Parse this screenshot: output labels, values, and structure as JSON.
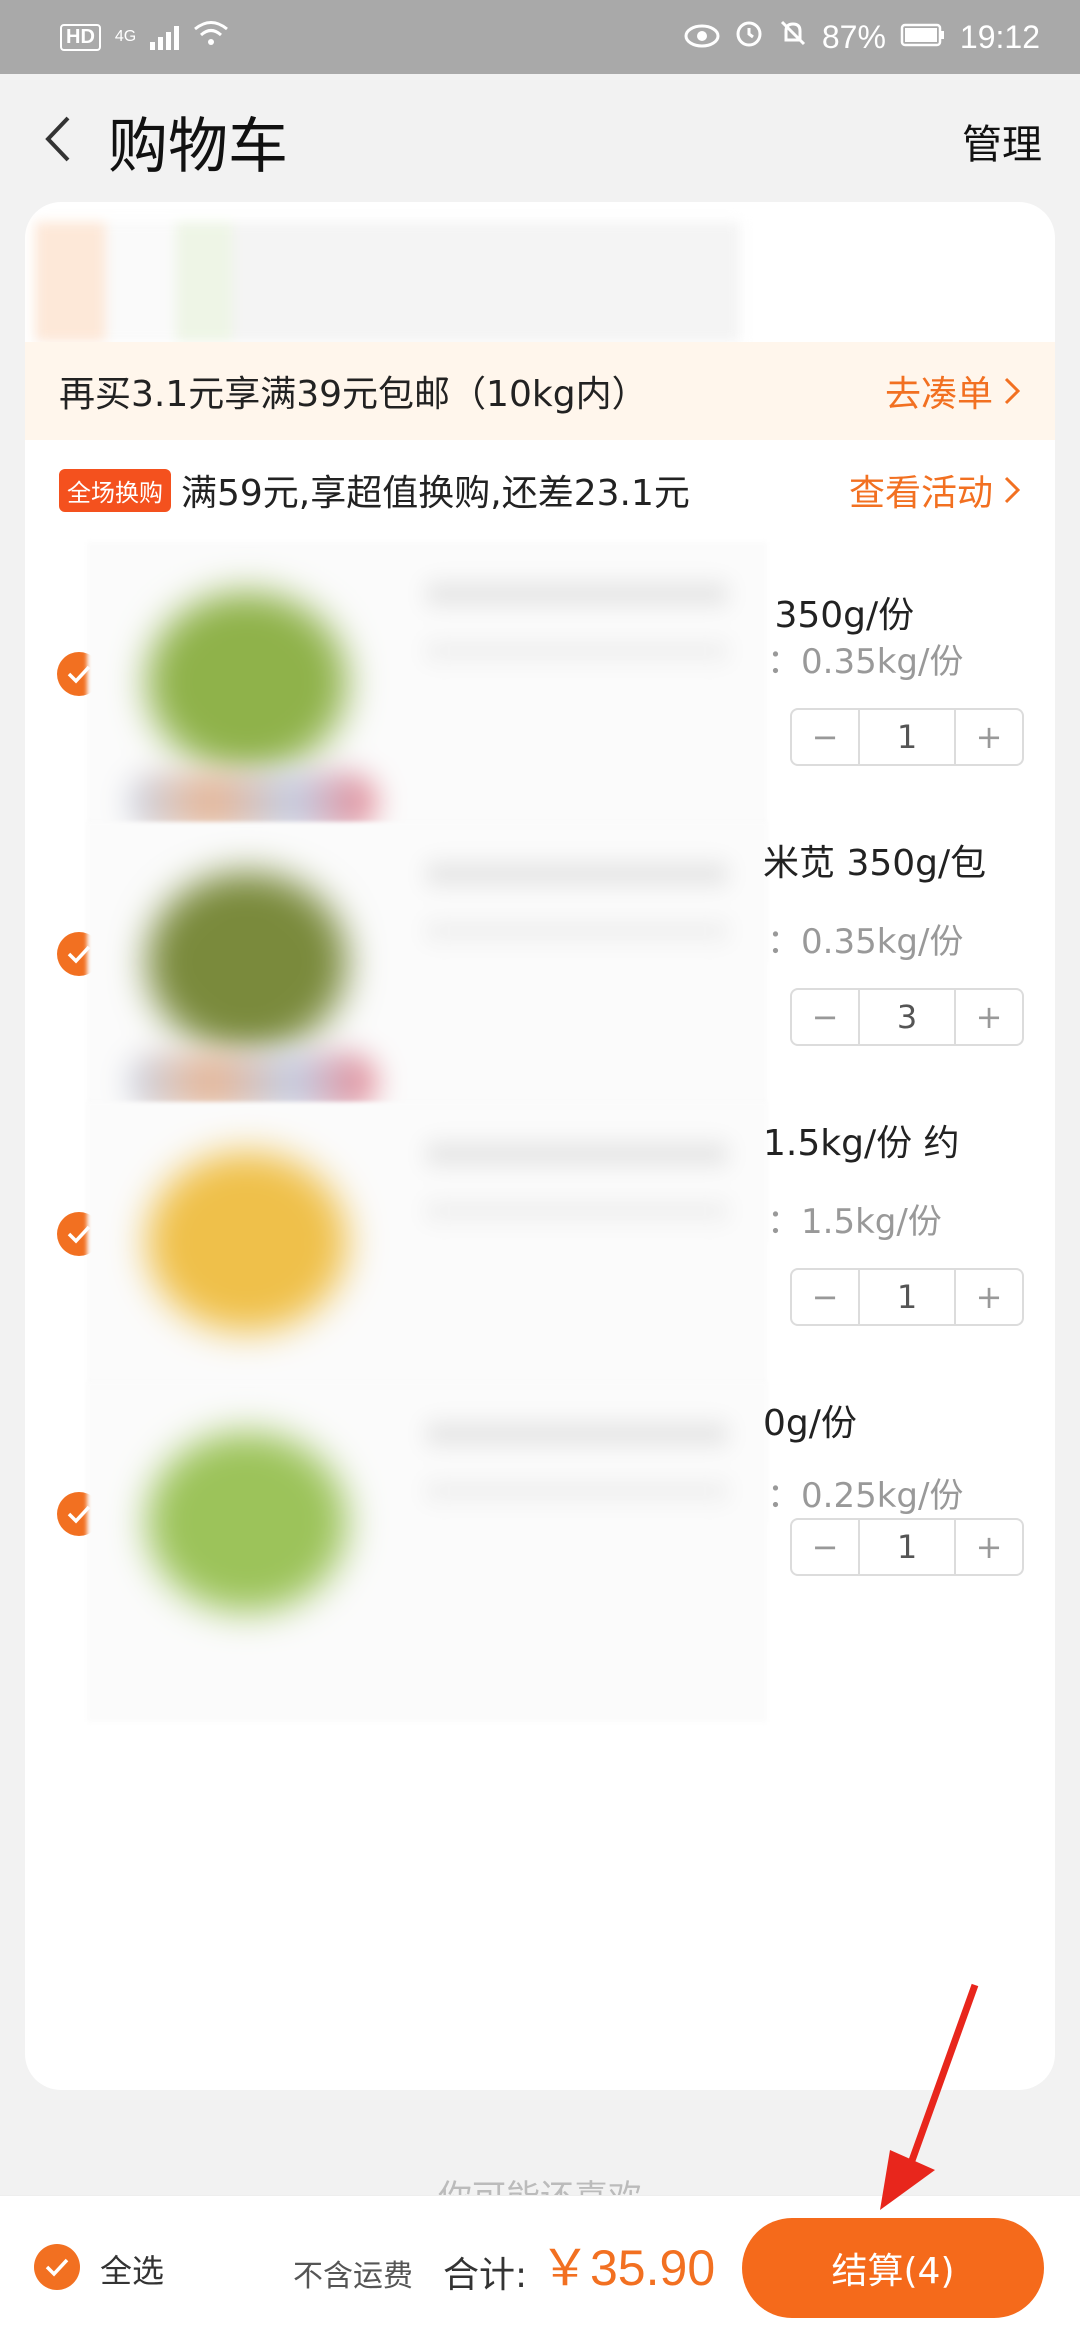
{
  "status_bar": {
    "hd": "HD",
    "network": "4G",
    "battery": "87%",
    "time": "19:12"
  },
  "header": {
    "title": "购物车",
    "manage_label": "管理"
  },
  "shipping": {
    "text": "再买3.1元享满39元包邮（10kg内）",
    "link_label": "去凑单"
  },
  "promo": {
    "tag": "全场换购",
    "text": "满59元,享超值换购,还差23.1元",
    "link_label": "查看活动"
  },
  "items": [
    {
      "name_suffix": " 350g/份",
      "spec": "：0.35kg/份",
      "qty": "1",
      "checked": true,
      "thumb_color": "#8fb24a"
    },
    {
      "name_suffix": "米苋 350g/包",
      "spec": "：0.35kg/份",
      "qty": "3",
      "checked": true,
      "thumb_color": "#7a8a3c"
    },
    {
      "name_suffix": "1.5kg/份 约",
      "spec": "：1.5kg/份",
      "qty": "1",
      "checked": true,
      "thumb_color": "#efc04a"
    },
    {
      "name_suffix": "0g/份",
      "spec": "：0.25kg/份",
      "qty": "1",
      "checked": true,
      "thumb_color": "#9cc35a"
    }
  ],
  "stepper": {
    "minus": "−",
    "plus": "+"
  },
  "more_hint": "你可能还喜欢",
  "bottom_bar": {
    "select_all_label": "全选",
    "fee_note": "不含运费",
    "total_label": "合计:",
    "total_value": "￥35.90",
    "checkout_label": "结算(4)"
  },
  "colors": {
    "accent": "#f27021",
    "checkout": "#f56a1b",
    "annotation_arrow": "#e8261c"
  }
}
